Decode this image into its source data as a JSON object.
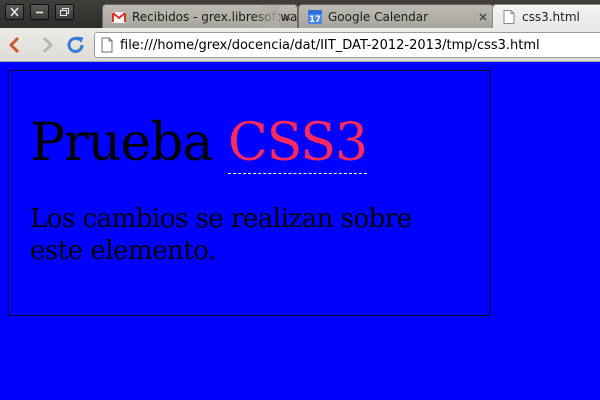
{
  "colors": {
    "page_background": "#0000ff",
    "box_border": "#000033",
    "heading_text": "#000000",
    "heading_accent": "#ff2a5c",
    "paragraph_text": "#000000",
    "gmail_red": "#d93025",
    "calendar_blue": "#4a86e8"
  },
  "window_controls": [
    {
      "icon": "close-icon"
    },
    {
      "icon": "minimize-icon"
    },
    {
      "icon": "maximize-icon"
    }
  ],
  "tabs": [
    {
      "title": "Recibidos - grex.libresoftwa",
      "favicon": "gmail-icon",
      "active": false
    },
    {
      "title": "Google Calendar",
      "favicon": "calendar-icon",
      "badge": "17",
      "active": false
    },
    {
      "title": "css3.html",
      "favicon": "document-icon",
      "active": true
    }
  ],
  "toolbar": {
    "back_icon": "back-arrow-icon",
    "forward_icon": "forward-arrow-icon",
    "reload_icon": "reload-icon",
    "url": "file:///home/grex/docencia/dat/IIT_DAT-2012-2013/tmp/css3.html"
  },
  "page": {
    "heading_prefix": "Prueba ",
    "heading_accent": "CSS3",
    "paragraph_lines": [
      "Los cambios se realizan sobre",
      "este elemento."
    ]
  }
}
